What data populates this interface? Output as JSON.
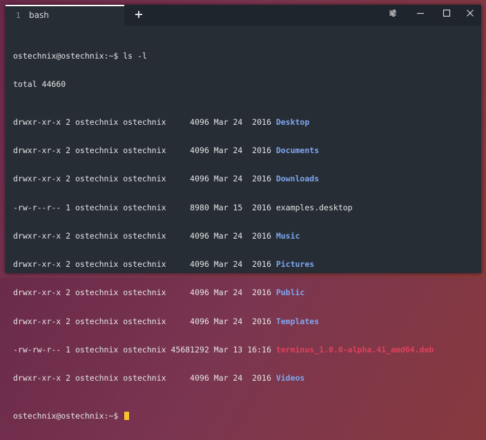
{
  "tab": {
    "number": "1",
    "title": "bash"
  },
  "tabbar": {
    "new_tab_label": "+"
  },
  "window_controls": {
    "settings": "⚙",
    "minimize": "—",
    "maximize": "☐",
    "close": "✕"
  },
  "terminal": {
    "command_line": {
      "prompt": "ostechnix@ostechnix:~$",
      "command": " ls -l"
    },
    "total_line": "total 44660",
    "entries": [
      {
        "meta": "drwxr-xr-x 2 ostechnix ostechnix     4096 Mar 24  2016 ",
        "name": "Desktop",
        "kind": "dir"
      },
      {
        "meta": "drwxr-xr-x 2 ostechnix ostechnix     4096 Mar 24  2016 ",
        "name": "Documents",
        "kind": "dir"
      },
      {
        "meta": "drwxr-xr-x 2 ostechnix ostechnix     4096 Mar 24  2016 ",
        "name": "Downloads",
        "kind": "dir"
      },
      {
        "meta": "-rw-r--r-- 1 ostechnix ostechnix     8980 Mar 15  2016 ",
        "name": "examples.desktop",
        "kind": "file"
      },
      {
        "meta": "drwxr-xr-x 2 ostechnix ostechnix     4096 Mar 24  2016 ",
        "name": "Music",
        "kind": "dir"
      },
      {
        "meta": "drwxr-xr-x 2 ostechnix ostechnix     4096 Mar 24  2016 ",
        "name": "Pictures",
        "kind": "dir"
      },
      {
        "meta": "drwxr-xr-x 2 ostechnix ostechnix     4096 Mar 24  2016 ",
        "name": "Public",
        "kind": "dir"
      },
      {
        "meta": "drwxr-xr-x 2 ostechnix ostechnix     4096 Mar 24  2016 ",
        "name": "Templates",
        "kind": "dir"
      },
      {
        "meta": "-rw-rw-r-- 1 ostechnix ostechnix 45681292 Mar 13 16:16 ",
        "name": "terminus_1.0.0-alpha.41_amd64.deb",
        "kind": "deb"
      },
      {
        "meta": "drwxr-xr-x 2 ostechnix ostechnix     4096 Mar 24  2016 ",
        "name": "Videos",
        "kind": "dir"
      }
    ],
    "final_prompt": "ostechnix@ostechnix:~$ "
  }
}
